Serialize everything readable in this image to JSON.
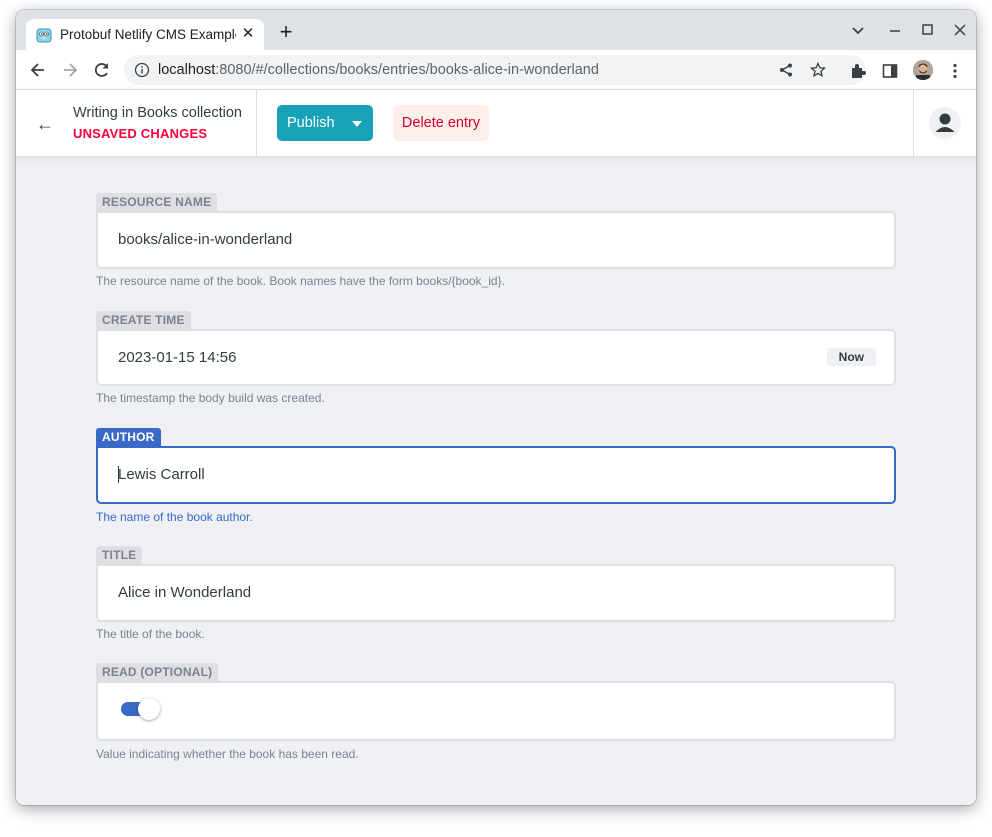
{
  "browser": {
    "tab_title": "Protobuf Netlify CMS Example",
    "url_host": "localhost",
    "url_rest": ":8080/#/collections/books/entries/books-alice-in-wonderland"
  },
  "header": {
    "title": "Writing in Books collection",
    "status": "UNSAVED CHANGES",
    "publish_label": "Publish",
    "delete_label": "Delete entry"
  },
  "fields": {
    "resource_name": {
      "label": "RESOURCE NAME",
      "value": "books/alice-in-wonderland",
      "hint": "The resource name of the book. Book names have the form books/{book_id}."
    },
    "create_time": {
      "label": "CREATE TIME",
      "value": "2023-01-15 14:56",
      "now_label": "Now",
      "hint": "The timestamp the body build was created."
    },
    "author": {
      "label": "AUTHOR",
      "value": "Lewis Carroll",
      "hint": "The name of the book author."
    },
    "title": {
      "label": "TITLE",
      "value": "Alice in Wonderland",
      "hint": "The title of the book."
    },
    "read": {
      "label": "READ (OPTIONAL)",
      "checked": true,
      "hint": "Value indicating whether the book has been read."
    }
  },
  "colors": {
    "accent": "#3a69c7",
    "publish": "#17a2b8",
    "danger": "#ff003b"
  }
}
